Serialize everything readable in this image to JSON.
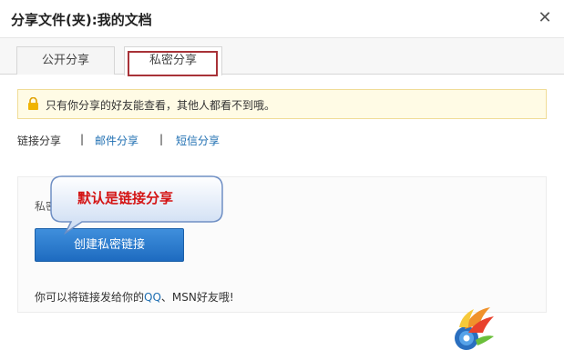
{
  "window": {
    "title": "分享文件(夹):我的文档",
    "close_icon": "close-icon"
  },
  "tabs": [
    {
      "label": "公开分享",
      "active": false
    },
    {
      "label": "私密分享",
      "active": true
    }
  ],
  "notice": {
    "icon": "lock-icon",
    "text": "只有你分享的好友能查看，其他人都看不到哦。",
    "bg_color": "#fffbe5",
    "border_color": "#f0dc96"
  },
  "share_methods": {
    "items": [
      "链接分享",
      "邮件分享",
      "短信分享"
    ],
    "separator": "|",
    "link_color": "#1f6fb2"
  },
  "private_link": {
    "label": "私密链接分享",
    "button_label": "创建私密链接",
    "hint_prefix": "你可以将链接发给你的",
    "hint_qq": "QQ",
    "hint_suffix": "、MSN好友哦!",
    "button_color": "#2a7ccf"
  },
  "callout": {
    "text": "默认是链接分享",
    "text_color": "#d41414"
  },
  "colors": {
    "tab_highlight_border": "#a83238",
    "accent": "#1f6fb2"
  },
  "logo": {
    "icon": "brand-logo-icon"
  }
}
